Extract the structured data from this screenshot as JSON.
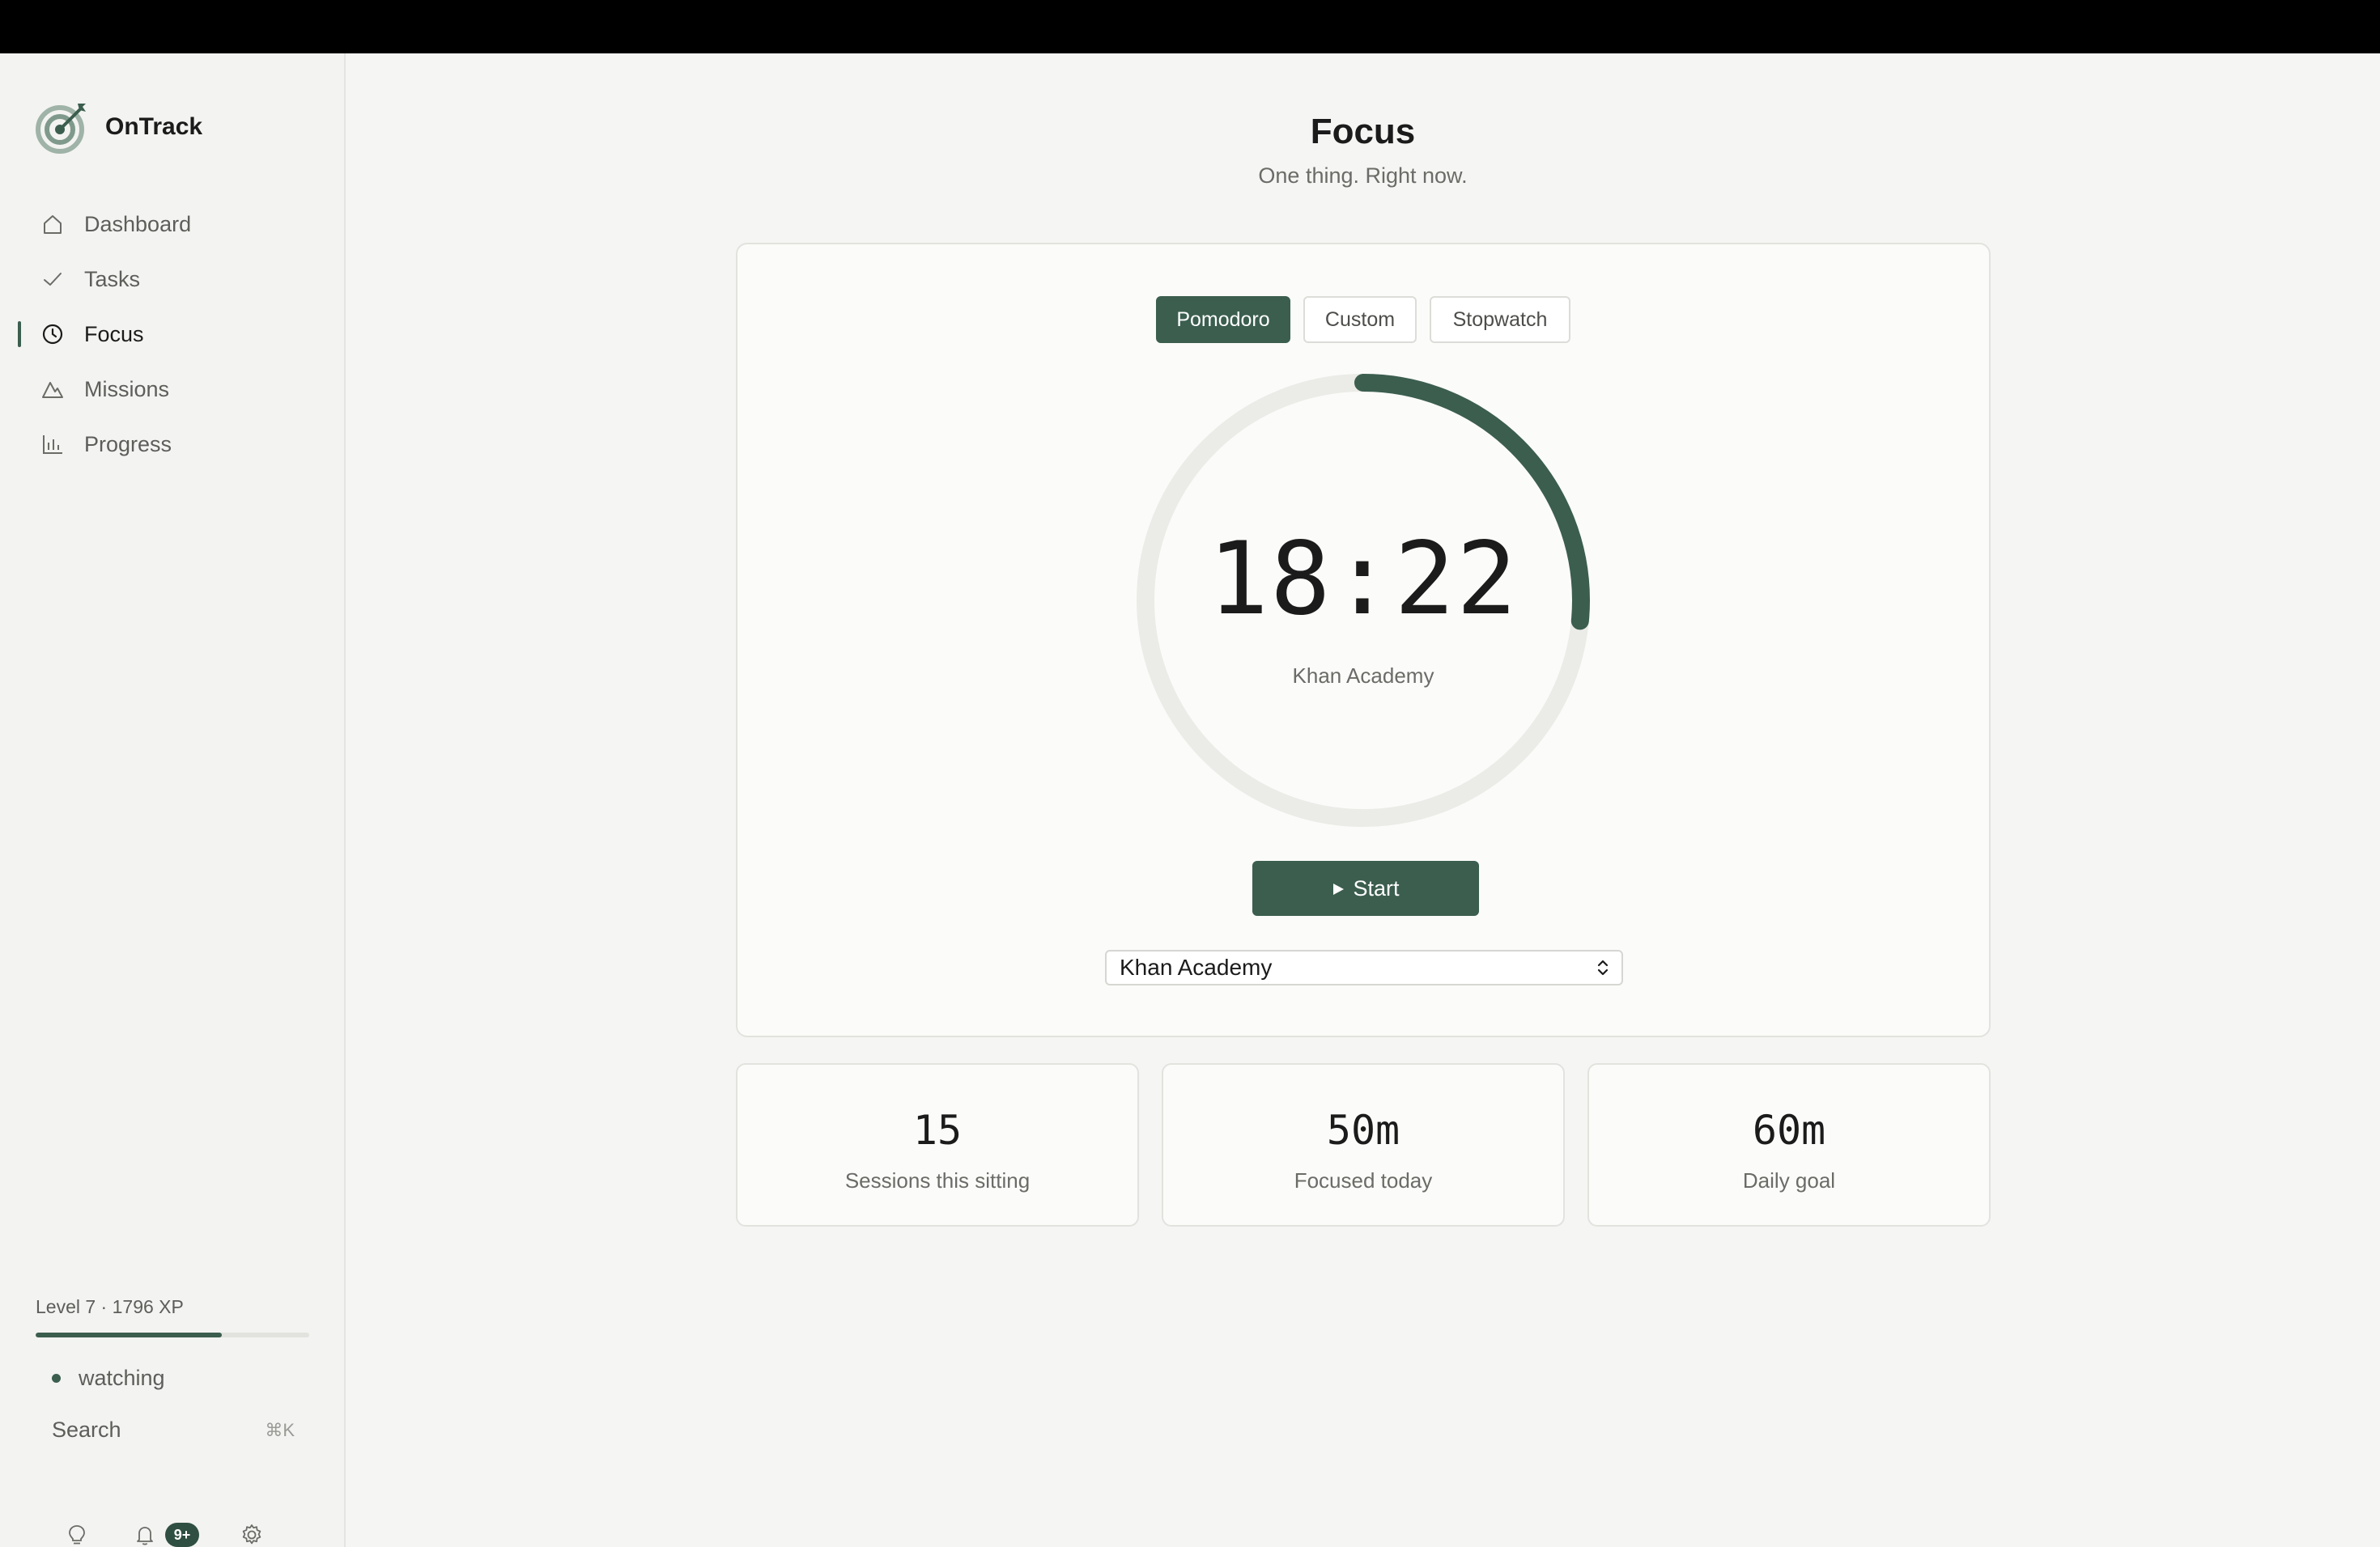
{
  "app": {
    "name": "OnTrack",
    "logo_icon": "target-icon"
  },
  "sidebar": {
    "items": [
      {
        "label": "Dashboard",
        "icon": "home-icon",
        "active": false
      },
      {
        "label": "Tasks",
        "icon": "check-icon",
        "active": false
      },
      {
        "label": "Focus",
        "icon": "clock-icon",
        "active": true
      },
      {
        "label": "Missions",
        "icon": "mountain-icon",
        "active": false
      },
      {
        "label": "Progress",
        "icon": "bar-chart-icon",
        "active": false
      }
    ],
    "level_label": "Level 7 · 1796 XP",
    "level_progress": 0.68,
    "status_text": "watching",
    "search_label": "Search",
    "search_shortcut": "⌘K",
    "notification_badge": "9+"
  },
  "page": {
    "title": "Focus",
    "subtitle": "One thing. Right now."
  },
  "timer": {
    "modes": [
      "Pomodoro",
      "Custom",
      "Stopwatch"
    ],
    "active_mode": "Pomodoro",
    "time": "18:22",
    "task": "Khan Academy",
    "remaining_fraction": 0.265,
    "start_label": "Start",
    "selected_task": "Khan Academy"
  },
  "stats": [
    {
      "value": "15",
      "label": "Sessions this sitting"
    },
    {
      "value": "50m",
      "label": "Focused today"
    },
    {
      "value": "60m",
      "label": "Daily goal"
    }
  ],
  "colors": {
    "accent": "#3b5e4f",
    "ring_track": "#ebebe8",
    "background": "#f5f5f3"
  }
}
